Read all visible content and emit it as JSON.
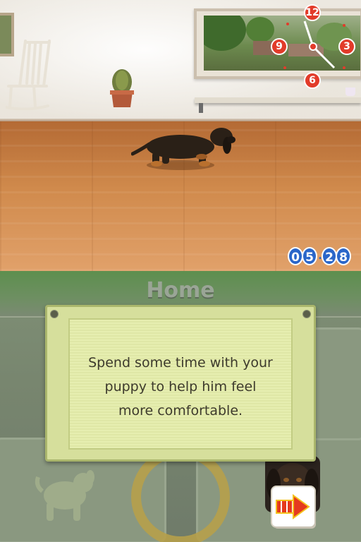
{
  "top_screen": {
    "clock": {
      "numbers": [
        "12",
        "3",
        "6",
        "9"
      ],
      "accent_color": "#e23b2a"
    },
    "time": {
      "hours": [
        "0",
        "5"
      ],
      "minutes": [
        "2",
        "8"
      ],
      "digit_color": "#2a66c9"
    }
  },
  "bottom_screen": {
    "header": {
      "title": "Home"
    },
    "dialog": {
      "lines": [
        "Spend some time with your",
        "puppy to help him feel",
        "more comfortable."
      ]
    },
    "next_button": {
      "icon": "arrow-right-icon",
      "color": "#e53a1e"
    }
  }
}
